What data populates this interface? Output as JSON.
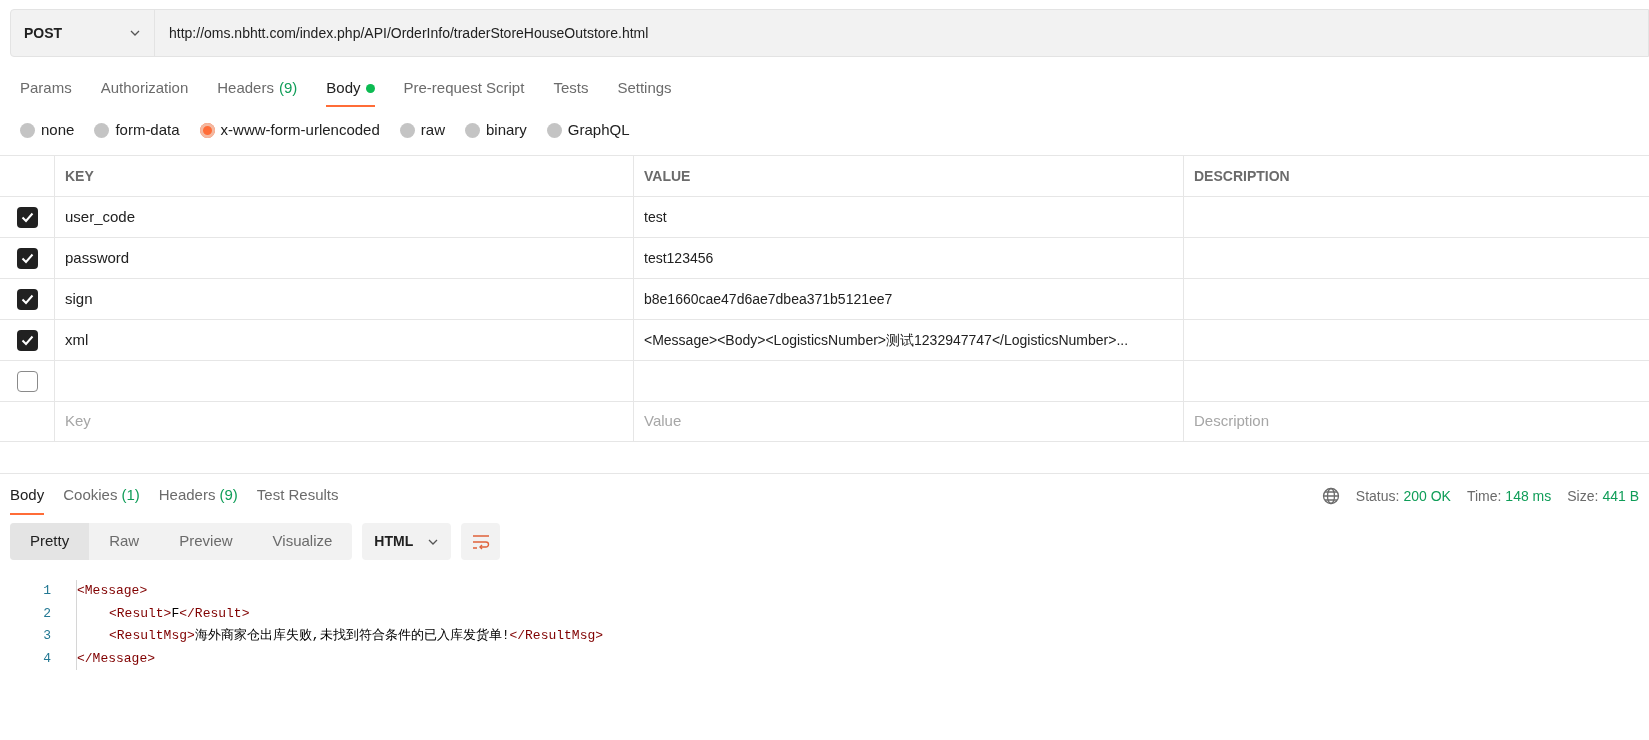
{
  "request": {
    "method": "POST",
    "url": "http://oms.nbhtt.com/index.php/API/OrderInfo/traderStoreHouseOutstore.html"
  },
  "request_tabs": [
    {
      "label": "Params",
      "selected": false
    },
    {
      "label": "Authorization",
      "selected": false
    },
    {
      "label": "Headers",
      "count": "(9)",
      "selected": false
    },
    {
      "label": "Body",
      "selected": true,
      "dot": true
    },
    {
      "label": "Pre-request Script",
      "selected": false
    },
    {
      "label": "Tests",
      "selected": false
    },
    {
      "label": "Settings",
      "selected": false
    }
  ],
  "body_types": [
    {
      "label": "none",
      "selected": false
    },
    {
      "label": "form-data",
      "selected": false
    },
    {
      "label": "x-www-form-urlencoded",
      "selected": true
    },
    {
      "label": "raw",
      "selected": false
    },
    {
      "label": "binary",
      "selected": false
    },
    {
      "label": "GraphQL",
      "selected": false
    }
  ],
  "params_table": {
    "columns": [
      "KEY",
      "VALUE",
      "DESCRIPTION"
    ],
    "rows": [
      {
        "checked": true,
        "key": "user_code",
        "value": "test"
      },
      {
        "checked": true,
        "key": "password",
        "value": "test123456"
      },
      {
        "checked": true,
        "key": "sign",
        "value": "b8e1660cae47d6ae7dbea371b5121ee7"
      },
      {
        "checked": true,
        "key": "xml",
        "value": "<Message><Body><LogisticsNumber>测试1232947747</LogisticsNumber>..."
      },
      {
        "checked": false
      }
    ],
    "placeholders": [
      "Key",
      "Value",
      "Description"
    ]
  },
  "response_tabs": [
    {
      "label": "Body",
      "selected": true
    },
    {
      "label": "Cookies",
      "count": "(1)",
      "selected": false
    },
    {
      "label": "Headers",
      "count": "(9)",
      "selected": false
    },
    {
      "label": "Test Results",
      "selected": false
    }
  ],
  "response_status": [
    {
      "label": "Status:",
      "value": "200 OK"
    },
    {
      "label": "Time:",
      "value": "148 ms"
    },
    {
      "label": "Size:",
      "value": "441 B"
    }
  ],
  "view_modes": [
    {
      "label": "Pretty",
      "selected": true
    },
    {
      "label": "Raw",
      "selected": false
    },
    {
      "label": "Preview",
      "selected": false
    },
    {
      "label": "Visualize",
      "selected": false
    }
  ],
  "format": "HTML",
  "code_lines": [
    {
      "number": "1",
      "indented": false,
      "parts": [
        {
          "kind": "tag",
          "text": "<Message>"
        }
      ]
    },
    {
      "number": "2",
      "indented": true,
      "parts": [
        {
          "kind": "tag",
          "text": "<Result>"
        },
        {
          "kind": "text",
          "text": "F"
        },
        {
          "kind": "tag",
          "text": "</Result>"
        }
      ]
    },
    {
      "number": "3",
      "indented": true,
      "parts": [
        {
          "kind": "tag",
          "text": "<ResultMsg>"
        },
        {
          "kind": "text",
          "text": "海外商家仓出库失败,未找到符合条件的已入库发货单!"
        },
        {
          "kind": "tag",
          "text": "</ResultMsg>"
        }
      ]
    },
    {
      "number": "4",
      "indented": false,
      "parts": [
        {
          "kind": "tag",
          "text": "</Message>"
        }
      ]
    }
  ]
}
